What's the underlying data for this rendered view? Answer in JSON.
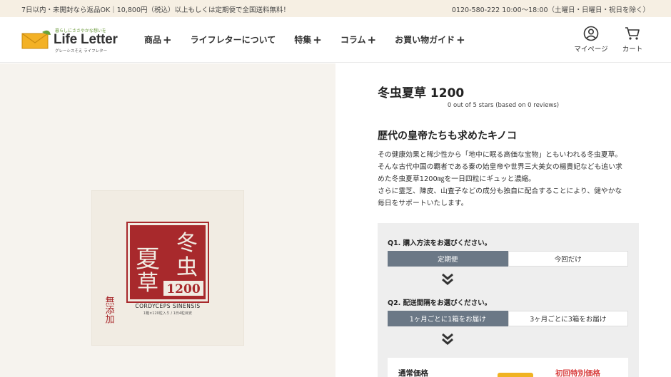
{
  "topbar": {
    "left_text": "7日以内・未開封なら返品OK｜10,800円（税込）以上もしくは定期便で全国送料無料！",
    "right_text": "0120-580-222 10:00～18:00（土曜日・日曜日・祝日を除く）"
  },
  "logo": {
    "tagline": "暮らしにささやかな想いを",
    "brand": "Life Letter",
    "sub": "グレーシスそえ ライフレター"
  },
  "nav": [
    {
      "label": "商品",
      "has_plus": true
    },
    {
      "label": "ライフレターについて",
      "has_plus": false
    },
    {
      "label": "特集",
      "has_plus": true
    },
    {
      "label": "コラム",
      "has_plus": true
    },
    {
      "label": "お買い物ガイド",
      "has_plus": true
    }
  ],
  "nav_plus": "+",
  "header_icons": {
    "mypage_label": "マイページ",
    "mypage_icon": "user-circle-icon",
    "cart_label": "カート",
    "cart_icon": "cart-icon"
  },
  "product_image": {
    "title_chars": "冬虫夏草",
    "number": "1200",
    "latin": "CORDYCEPS SINENSIS",
    "small": "1箱×120粒入り / 1日4粒目安",
    "side": "無添加"
  },
  "product": {
    "title": "冬虫夏草 1200",
    "reviews": "0 out of 5 stars (based on 0 reviews)",
    "catch": "歴代の皇帝たちも求めたキノコ",
    "description_lines": [
      "その健康効果と稀少性から「地中に眠る高価な宝物」ともいわれる冬虫夏草。",
      "そんな古代中国の覇者である秦の始皇帝や世界三大美女の楊貴妃なども追い求",
      "めた冬虫夏草1200㎎を一日四粒にギュッと濃縮。",
      "さらに霊芝、陳皮、山査子などの成分も独自に配合することにより、健やかな",
      "毎日をサポートいたします。"
    ]
  },
  "purchase": {
    "q1": "Q1. 購入方法をお選びください。",
    "q1_options": [
      "定期便",
      "今回だけ"
    ],
    "q1_selected": 0,
    "q2": "Q2. 配送間隔をお選びください。",
    "q2_options": [
      "1ヶ月ごとに1箱をお届け",
      "3ヶ月ごとに3箱をお届け"
    ],
    "q2_selected": 0,
    "price_label": "通常価格",
    "special_label": "初回特別価格"
  },
  "colors": {
    "topbar_bg": "#f6efe3",
    "image_bg": "#f6f3ee",
    "selected_option": "#6b7886",
    "seal_red": "#a8292c",
    "special_price": "#d94040",
    "badge": "#f0b323"
  }
}
